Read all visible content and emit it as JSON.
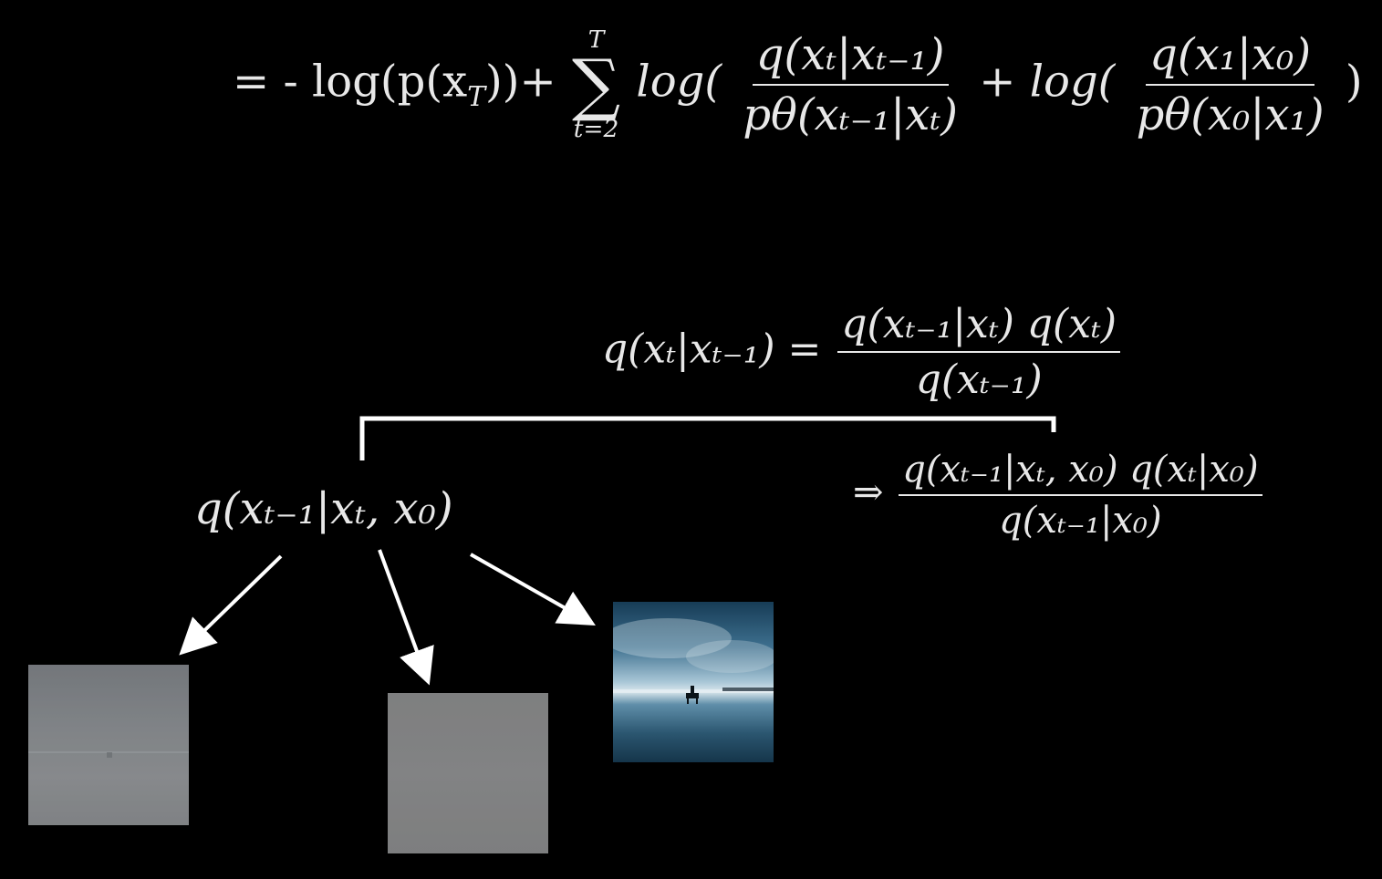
{
  "equations": {
    "loss_line": {
      "prefix": "= - log(p(x",
      "prefix_sub": "T",
      "prefix_close": "))+",
      "sum_top": "T",
      "sum_bottom": "t=2",
      "log1": "log(",
      "frac1_num": "q(xₜ|xₜ₋₁)",
      "frac1_den": "pθ(xₜ₋₁|xₜ)",
      "plus": "+",
      "log2": "log(",
      "frac2_num": "q(x₁|x₀)",
      "frac2_den": "pθ(x₀|x₁)",
      "close": ")"
    },
    "bayes_line": {
      "lhs": "q(xₜ|xₜ₋₁) =",
      "num": "q(xₜ₋₁|xₜ) q(xₜ)",
      "den": "q(xₜ₋₁)"
    },
    "conditioned_line": {
      "arrow": "⇒",
      "num": "q(xₜ₋₁|xₜ, x₀) q(xₜ|x₀)",
      "den": "q(xₜ₋₁|x₀)"
    },
    "posterior_label": "q(xₜ₋₁|xₜ, x₀)"
  },
  "images": [
    {
      "name": "noisy-image-xt-1",
      "description_icon": "image-icon"
    },
    {
      "name": "noisy-image-xt",
      "description_icon": "image-icon"
    },
    {
      "name": "clean-image-x0",
      "description_icon": "image-icon"
    }
  ],
  "colors": {
    "background": "#000000",
    "text": "#e8e8e8",
    "lines": "#ffffff"
  }
}
